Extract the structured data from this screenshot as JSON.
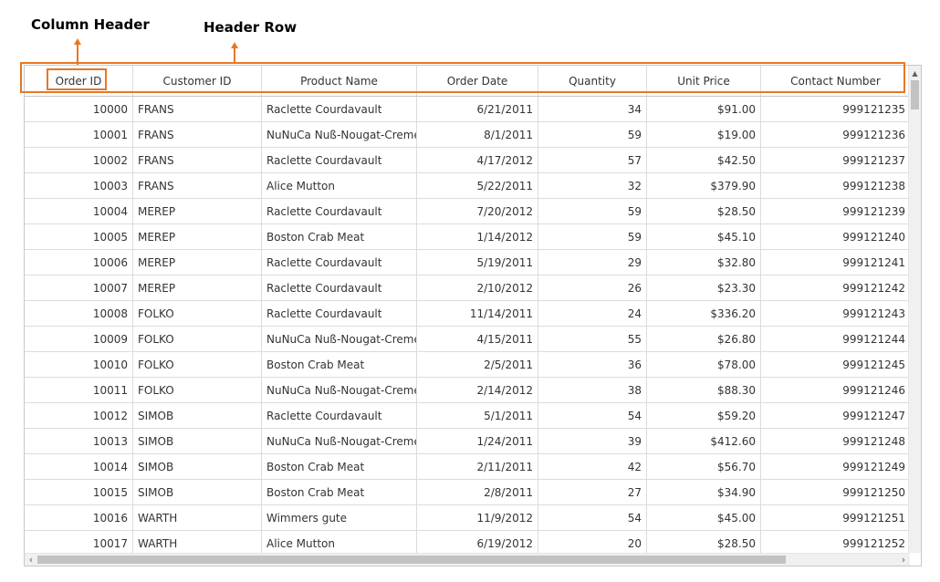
{
  "annotations": {
    "column_header": "Column Header",
    "header_row": "Header Row"
  },
  "colors": {
    "accent": "#e87722",
    "grid_line": "#dcdcdc",
    "scrollbar_thumb": "#c2c2c2"
  },
  "columns": [
    "Order ID",
    "Customer ID",
    "Product Name",
    "Order Date",
    "Quantity",
    "Unit Price",
    "Contact Number"
  ],
  "rows": [
    [
      "10000",
      "FRANS",
      "Raclette Courdavault",
      "6/21/2011",
      "34",
      "$91.00",
      "999121235"
    ],
    [
      "10001",
      "FRANS",
      "NuNuCa Nuß-Nougat-Creme",
      "8/1/2011",
      "59",
      "$19.00",
      "999121236"
    ],
    [
      "10002",
      "FRANS",
      "Raclette Courdavault",
      "4/17/2012",
      "57",
      "$42.50",
      "999121237"
    ],
    [
      "10003",
      "FRANS",
      "Alice Mutton",
      "5/22/2011",
      "32",
      "$379.90",
      "999121238"
    ],
    [
      "10004",
      "MEREP",
      "Raclette Courdavault",
      "7/20/2012",
      "59",
      "$28.50",
      "999121239"
    ],
    [
      "10005",
      "MEREP",
      "Boston Crab Meat",
      "1/14/2012",
      "59",
      "$45.10",
      "999121240"
    ],
    [
      "10006",
      "MEREP",
      "Raclette Courdavault",
      "5/19/2011",
      "29",
      "$32.80",
      "999121241"
    ],
    [
      "10007",
      "MEREP",
      "Raclette Courdavault",
      "2/10/2012",
      "26",
      "$23.30",
      "999121242"
    ],
    [
      "10008",
      "FOLKO",
      "Raclette Courdavault",
      "11/14/2011",
      "24",
      "$336.20",
      "999121243"
    ],
    [
      "10009",
      "FOLKO",
      "NuNuCa Nuß-Nougat-Creme",
      "4/15/2011",
      "55",
      "$26.80",
      "999121244"
    ],
    [
      "10010",
      "FOLKO",
      "Boston Crab Meat",
      "2/5/2011",
      "36",
      "$78.00",
      "999121245"
    ],
    [
      "10011",
      "FOLKO",
      "NuNuCa Nuß-Nougat-Creme",
      "2/14/2012",
      "38",
      "$88.30",
      "999121246"
    ],
    [
      "10012",
      "SIMOB",
      "Raclette Courdavault",
      "5/1/2011",
      "54",
      "$59.20",
      "999121247"
    ],
    [
      "10013",
      "SIMOB",
      "NuNuCa Nuß-Nougat-Creme",
      "1/24/2011",
      "39",
      "$412.60",
      "999121248"
    ],
    [
      "10014",
      "SIMOB",
      "Boston Crab Meat",
      "2/11/2011",
      "42",
      "$56.70",
      "999121249"
    ],
    [
      "10015",
      "SIMOB",
      "Boston Crab Meat",
      "2/8/2011",
      "27",
      "$34.90",
      "999121250"
    ],
    [
      "10016",
      "WARTH",
      "Wimmers gute",
      "11/9/2012",
      "54",
      "$45.00",
      "999121251"
    ],
    [
      "10017",
      "WARTH",
      "Alice Mutton",
      "6/19/2012",
      "20",
      "$28.50",
      "999121252"
    ]
  ],
  "scrollbars": {
    "up_icon": "chevron-up-icon",
    "left_icon": "chevron-left-icon",
    "right_icon": "chevron-right-icon"
  }
}
